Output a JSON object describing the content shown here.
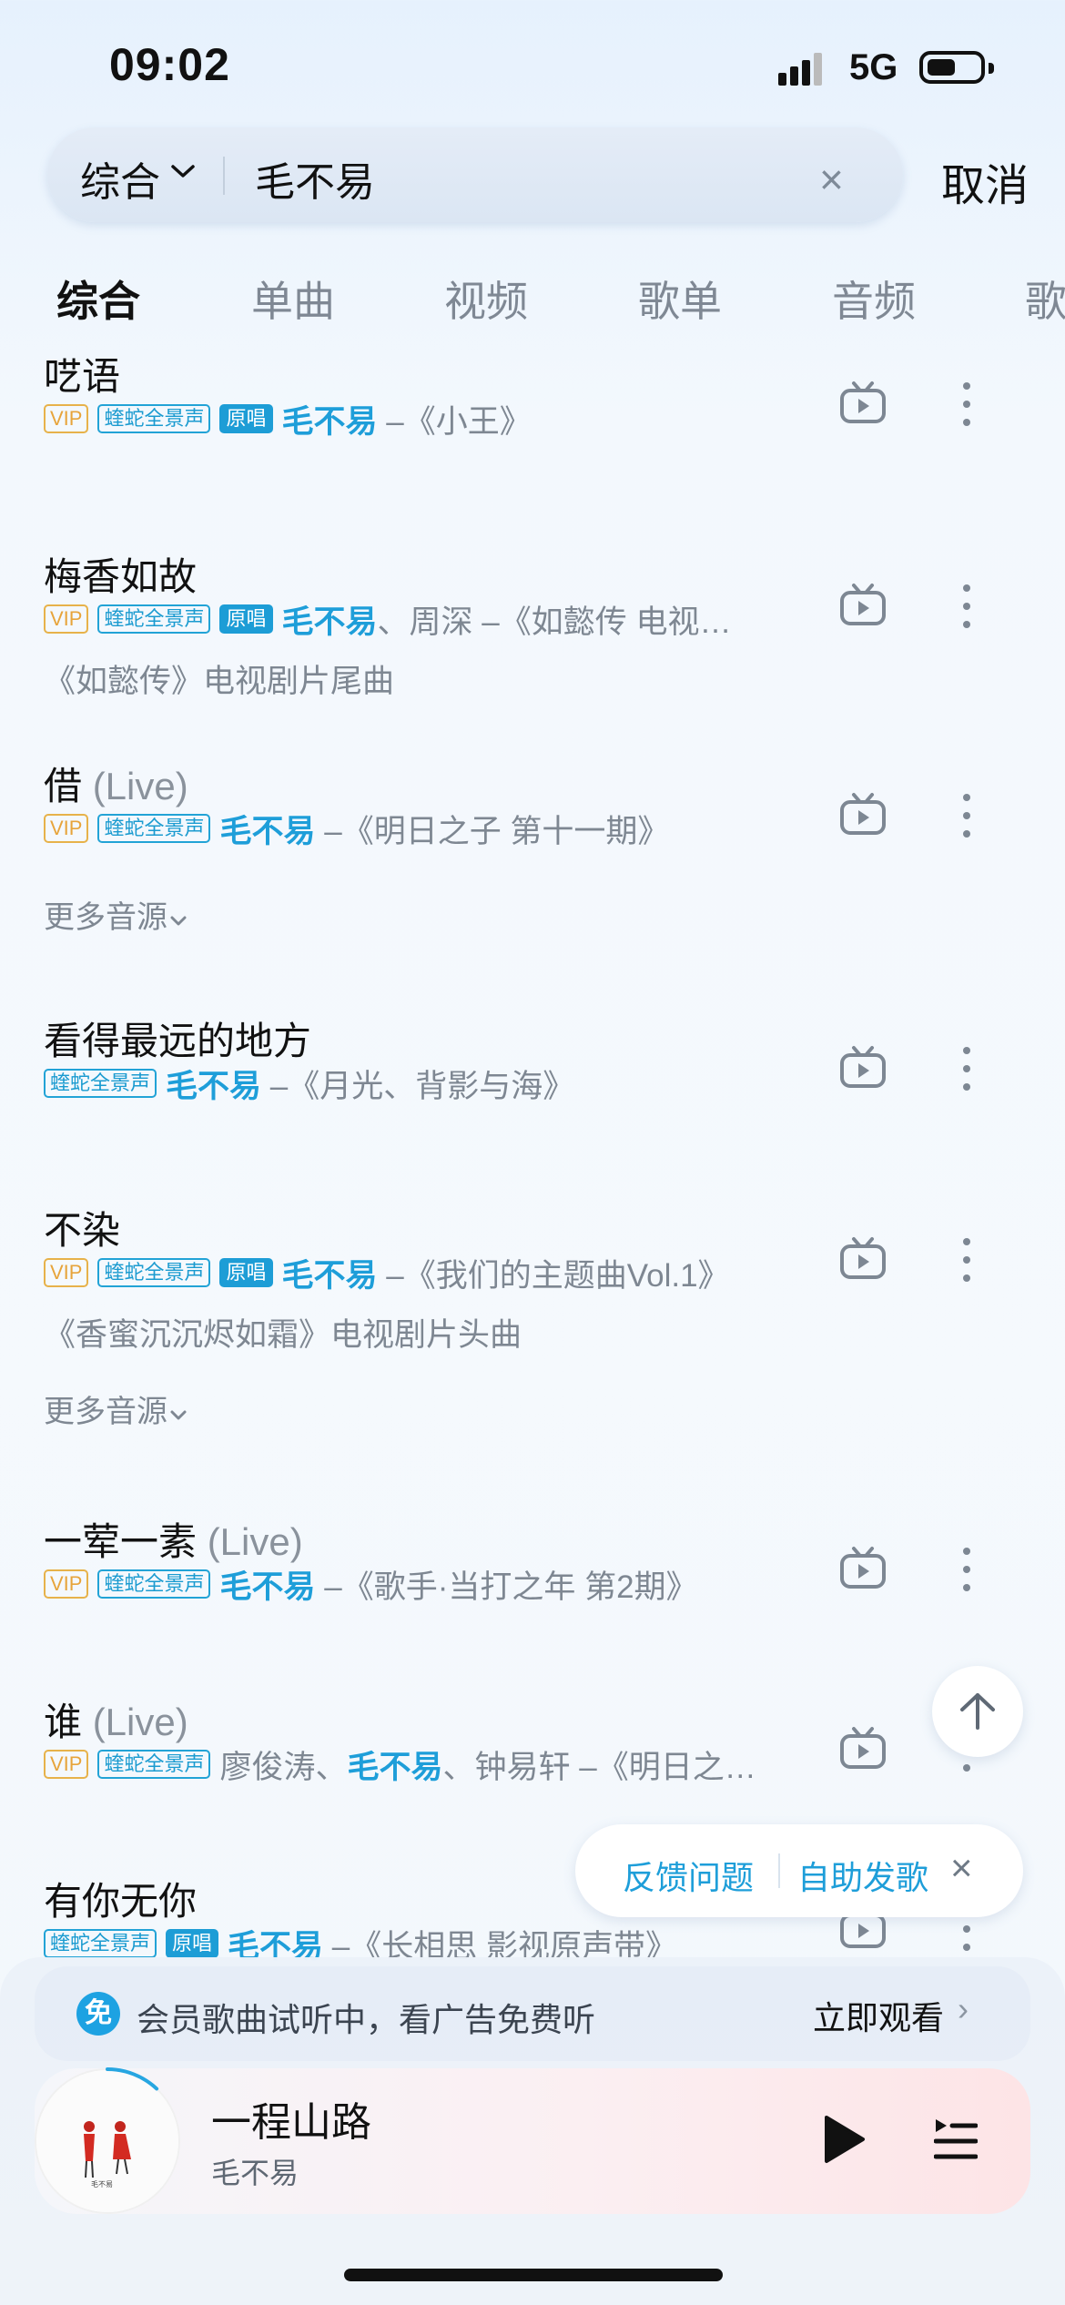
{
  "status_bar": {
    "time": "09:02",
    "network": "5G"
  },
  "search": {
    "scope": "综合",
    "query": "毛不易",
    "cancel_label": "取消"
  },
  "tabs": [
    {
      "label": "综合",
      "active": true
    },
    {
      "label": "单曲",
      "active": false
    },
    {
      "label": "视频",
      "active": false
    },
    {
      "label": "歌单",
      "active": false
    },
    {
      "label": "音频",
      "active": false
    },
    {
      "label": "歌",
      "active": false
    }
  ],
  "badges": {
    "vip": "VIP",
    "snake": "蝰蛇全景声",
    "original": "原唱"
  },
  "songs": [
    {
      "title": "呓语",
      "live": "",
      "artists_pre": "",
      "artist_hl": "毛不易",
      "artists_post": "",
      "album": "–《小王》",
      "desc": "",
      "more_sources": ""
    },
    {
      "title": "梅香如故",
      "live": "",
      "artists_pre": "",
      "artist_hl": "毛不易",
      "artists_post": "、周深",
      "album": "–《如懿传 电视…",
      "desc": "《如懿传》电视剧片尾曲",
      "more_sources": ""
    },
    {
      "title": "借",
      "live": "(Live)",
      "artists_pre": "",
      "artist_hl": "毛不易",
      "artists_post": "",
      "album": "–《明日之子 第十一期》",
      "desc": "",
      "more_sources": "更多音源"
    },
    {
      "title": "看得最远的地方",
      "live": "",
      "artists_pre": "",
      "artist_hl": "毛不易",
      "artists_post": "",
      "album": "–《月光、背影与海》",
      "desc": "",
      "more_sources": ""
    },
    {
      "title": "不染",
      "live": "",
      "artists_pre": "",
      "artist_hl": "毛不易",
      "artists_post": "",
      "album": "–《我们的主题曲Vol.1》",
      "desc": "《香蜜沉沉烬如霜》电视剧片头曲",
      "more_sources": "更多音源"
    },
    {
      "title": "一荤一素",
      "live": "(Live)",
      "artists_pre": "",
      "artist_hl": "毛不易",
      "artists_post": "",
      "album": "–《歌手·当打之年 第2期》",
      "desc": "",
      "more_sources": ""
    },
    {
      "title": "谁",
      "live": "(Live)",
      "artists_pre": "廖俊涛、",
      "artist_hl": "毛不易",
      "artists_post": "、钟易轩",
      "album": "–《明日之…",
      "desc": "",
      "more_sources": ""
    },
    {
      "title": "有你无你",
      "live": "",
      "artists_pre": "",
      "artist_hl": "毛不易",
      "artists_post": "",
      "album": "–《长相思 影视原声带》",
      "desc": "",
      "more_sources": ""
    }
  ],
  "feedback": {
    "report": "反馈问题",
    "self_publish": "自助发歌"
  },
  "ad_banner": {
    "free_badge": "免",
    "text": "会员歌曲试听中，看广告免费听",
    "action": "立即观看"
  },
  "now_playing": {
    "title": "一程山路",
    "artist": "毛不易",
    "cover_caption": "毛不易",
    "progress": 0.12
  },
  "colors": {
    "accent": "#1e9ed9",
    "vip": "#e7a43b"
  }
}
